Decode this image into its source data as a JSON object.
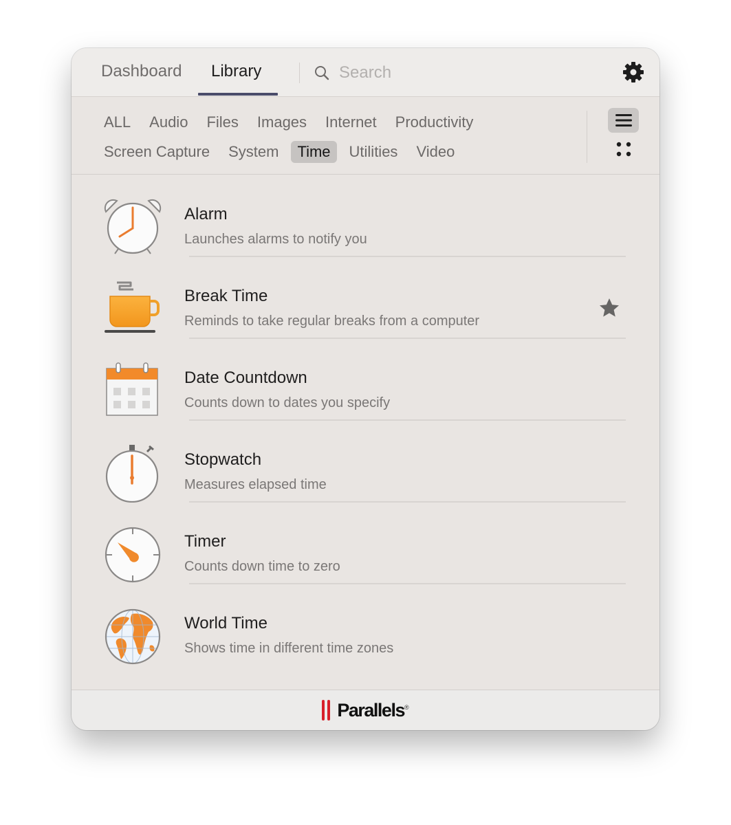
{
  "header": {
    "tabs": [
      {
        "label": "Dashboard",
        "active": false
      },
      {
        "label": "Library",
        "active": true
      }
    ],
    "search": {
      "placeholder": "Search",
      "value": ""
    },
    "settings_icon": "gear-icon"
  },
  "categories": {
    "row1": [
      "ALL",
      "Audio",
      "Files",
      "Images",
      "Internet",
      "Productivity"
    ],
    "row2": [
      "Screen Capture",
      "System",
      "Time",
      "Utilities",
      "Video"
    ],
    "active": "Time",
    "view_modes": [
      {
        "name": "list",
        "icon": "list-view-icon",
        "active": true
      },
      {
        "name": "grid",
        "icon": "grid-view-icon",
        "active": false
      }
    ]
  },
  "items": [
    {
      "title": "Alarm",
      "description": "Launches alarms to notify you",
      "icon": "alarm-clock-icon",
      "favorite": false
    },
    {
      "title": "Break Time",
      "description": "Reminds to take regular breaks from a computer",
      "icon": "coffee-cup-icon",
      "favorite": true
    },
    {
      "title": "Date Countdown",
      "description": "Counts down to dates you specify",
      "icon": "calendar-icon",
      "favorite": false
    },
    {
      "title": "Stopwatch",
      "description": "Measures elapsed time",
      "icon": "stopwatch-icon",
      "favorite": false
    },
    {
      "title": "Timer",
      "description": "Counts down time to zero",
      "icon": "timer-icon",
      "favorite": false
    },
    {
      "title": "World Time",
      "description": "Shows time in different time zones",
      "icon": "globe-icon",
      "favorite": false
    }
  ],
  "footer": {
    "brand": "Parallels",
    "reg_mark": "®"
  },
  "colors": {
    "accent_orange": "#f08a2c",
    "tab_underline": "#4a4c6a",
    "logo_red": "#d8202a",
    "window_bg": "#e9e5e2"
  }
}
